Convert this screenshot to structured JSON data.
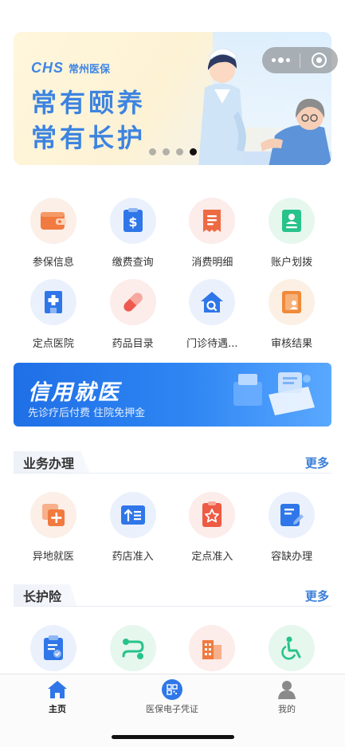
{
  "banner": {
    "logo_mark": "CHS",
    "logo_text": "常州医保",
    "slogan_line1": "常有颐养",
    "slogan_line2": "常有长护",
    "page_count": 4,
    "active_page": 4
  },
  "grid_row1": [
    {
      "label": "参保信息",
      "icon": "wallet-icon"
    },
    {
      "label": "缴费查询",
      "icon": "dollar-bill-icon"
    },
    {
      "label": "消费明细",
      "icon": "receipt-icon"
    },
    {
      "label": "账户划拨",
      "icon": "account-card-icon"
    }
  ],
  "grid_row2": [
    {
      "label": "定点医院",
      "icon": "hospital-icon"
    },
    {
      "label": "药品目录",
      "icon": "pill-icon"
    },
    {
      "label": "门诊待遇...",
      "icon": "house-search-icon"
    },
    {
      "label": "审核结果",
      "icon": "document-person-icon"
    }
  ],
  "credit_banner": {
    "title": "信用就医",
    "subtitle": "先诊疗后付费 住院免押金"
  },
  "section_business": {
    "title": "业务办理",
    "more": "更多",
    "items": [
      {
        "label": "异地就医",
        "icon": "copy-plus-icon"
      },
      {
        "label": "药店准入",
        "icon": "upload-list-icon"
      },
      {
        "label": "定点准入",
        "icon": "star-badge-icon"
      },
      {
        "label": "容缺办理",
        "icon": "edit-document-icon"
      }
    ]
  },
  "section_ltc": {
    "title": "长护险",
    "more": "更多",
    "items": [
      {
        "label": "",
        "icon": "clipboard-check-icon"
      },
      {
        "label": "",
        "icon": "route-icon"
      },
      {
        "label": "",
        "icon": "building-icon"
      },
      {
        "label": "",
        "icon": "wheelchair-icon"
      }
    ]
  },
  "tabbar": {
    "home": "主页",
    "card": "医保电子凭证",
    "me": "我的",
    "active": "home"
  },
  "colors": {
    "accent_blue": "#3b7fd9",
    "banner_blue": "#3d84e0",
    "credit_blue": "#1f6fe6"
  }
}
